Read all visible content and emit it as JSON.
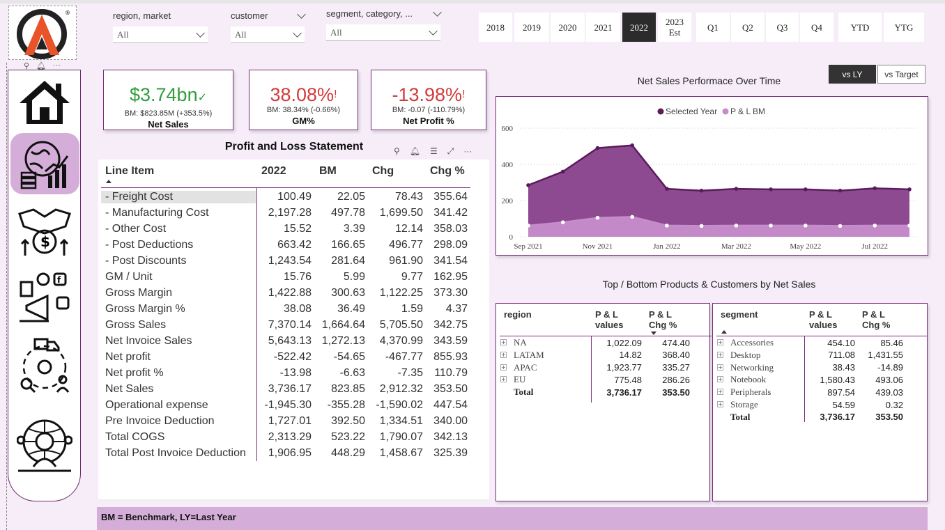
{
  "filters": [
    {
      "label": "region, market",
      "value": "All"
    },
    {
      "label": "customer",
      "value": "All"
    },
    {
      "label": "segment, category, ...",
      "value": "All"
    }
  ],
  "periods": [
    "2018",
    "2019",
    "2020",
    "2021",
    "2022",
    "2023\nEst",
    "Q1",
    "Q2",
    "Q3",
    "Q4",
    "YTD",
    "YTG"
  ],
  "active_period": "2022",
  "compare": {
    "vs_ly": "vs LY",
    "vs_target": "vs Target"
  },
  "kpis": [
    {
      "value": "$3.74bn",
      "icon": "✓",
      "bm": "BM: $823.85M (+353.5%)",
      "name": "Net Sales",
      "color": "#2e9e3c"
    },
    {
      "value": "38.08%",
      "icon": "!",
      "bm": "BM: 38.34% (-0.66%)",
      "name": "GM%",
      "color": "#d23a3a"
    },
    {
      "value": "-13.98%",
      "icon": "!",
      "bm": "BM: -0.07 (-110.79%)",
      "name": "Net Profit %",
      "color": "#d23a3a"
    }
  ],
  "pl": {
    "title": "Profit and Loss Statement",
    "headers": [
      "Line Item",
      "2022",
      "BM",
      "Chg",
      "Chg %"
    ],
    "rows": [
      [
        "- Freight Cost",
        "100.49",
        "22.05",
        "78.43",
        "355.64"
      ],
      [
        "- Manufacturing Cost",
        "2,197.28",
        "497.78",
        "1,699.50",
        "341.42"
      ],
      [
        "- Other Cost",
        "15.52",
        "3.39",
        "12.14",
        "358.03"
      ],
      [
        "- Post Deductions",
        "663.42",
        "166.65",
        "496.77",
        "298.09"
      ],
      [
        "- Post Discounts",
        "1,243.54",
        "281.64",
        "961.90",
        "341.54"
      ],
      [
        "GM / Unit",
        "15.76",
        "5.99",
        "9.77",
        "162.95"
      ],
      [
        "Gross Margin",
        "1,422.88",
        "300.63",
        "1,122.25",
        "373.30"
      ],
      [
        "Gross Margin %",
        "38.08",
        "36.49",
        "1.59",
        "4.37"
      ],
      [
        "Gross Sales",
        "7,370.14",
        "1,664.64",
        "5,705.50",
        "342.75"
      ],
      [
        "Net Invoice Sales",
        "5,643.13",
        "1,272.13",
        "4,370.99",
        "343.59"
      ],
      [
        "Net profit",
        "-522.42",
        "-54.65",
        "-467.77",
        "855.93"
      ],
      [
        "Net profit %",
        "-13.98",
        "-6.63",
        "-7.35",
        "110.79"
      ],
      [
        "Net Sales",
        "3,736.17",
        "823.85",
        "2,912.32",
        "353.50"
      ],
      [
        "Operational expense",
        "-1,945.30",
        "-355.28",
        "-1,590.02",
        "447.54"
      ],
      [
        "Pre Invoice Deduction",
        "1,727.01",
        "392.50",
        "1,334.51",
        "340.00"
      ],
      [
        "Total COGS",
        "2,313.29",
        "523.22",
        "1,790.07",
        "342.13"
      ],
      [
        "Total Post Invoice Deduction",
        "1,906.95",
        "448.29",
        "1,458.67",
        "325.39"
      ]
    ]
  },
  "chart_data": {
    "type": "area",
    "title": "Net Sales Performace Over Time",
    "x": [
      "Sep 2021",
      "Oct 2021",
      "Nov 2021",
      "Dec 2021",
      "Jan 2022",
      "Feb 2022",
      "Mar 2022",
      "Apr 2022",
      "May 2022",
      "Jun 2022",
      "Jul 2022",
      "Aug 2022"
    ],
    "xticks": [
      "Sep 2021",
      "Nov 2021",
      "Jan 2022",
      "Mar 2022",
      "May 2022",
      "Jul 2022"
    ],
    "series": [
      {
        "name": "Selected Year",
        "color": "#5a1b5c",
        "values": [
          285,
          360,
          490,
          505,
          265,
          255,
          265,
          262,
          262,
          255,
          268,
          262
        ]
      },
      {
        "name": "P & L BM",
        "color": "#c68ccb",
        "values": [
          62,
          80,
          105,
          110,
          62,
          60,
          62,
          62,
          62,
          60,
          62,
          62
        ]
      }
    ],
    "yticks": [
      0,
      200,
      400,
      600
    ],
    "ylim": [
      0,
      600
    ],
    "legend": "top-center"
  },
  "products_title": "Top / Bottom Products & Customers by Net Sales",
  "region_table": {
    "headers": [
      "region",
      "P & L\nvalues",
      "P & L\nChg %"
    ],
    "rows": [
      [
        "NA",
        "1,022.09",
        "474.40"
      ],
      [
        "LATAM",
        "14.82",
        "368.40"
      ],
      [
        "APAC",
        "1,923.77",
        "335.27"
      ],
      [
        "EU",
        "775.48",
        "286.26"
      ]
    ],
    "total": [
      "Total",
      "3,736.17",
      "353.50"
    ]
  },
  "segment_table": {
    "headers": [
      "segment",
      "P & L\nvalues",
      "P & L\nChg %"
    ],
    "rows": [
      [
        "Accessories",
        "454.10",
        "85.46"
      ],
      [
        "Desktop",
        "711.08",
        "1,431.55"
      ],
      [
        "Networking",
        "38.43",
        "-14.89"
      ],
      [
        "Notebook",
        "1,580.43",
        "493.06"
      ],
      [
        "Peripherals",
        "897.54",
        "439.03"
      ],
      [
        "Storage",
        "54.59",
        "0.32"
      ]
    ],
    "total": [
      "Total",
      "3,736.17",
      "353.50"
    ]
  },
  "footer": "BM = Benchmark, LY=Last Year",
  "nav_icons": [
    "home-icon",
    "finance-globe-icon",
    "handshake-money-icon",
    "marketing-icon",
    "supply-chain-icon",
    "executive-icon"
  ],
  "colors": {
    "accent": "#7a2c7a",
    "dark_purple": "#5a1b5c",
    "light_purple": "#c68ccb",
    "sidebar_active": "#d4aed8"
  }
}
